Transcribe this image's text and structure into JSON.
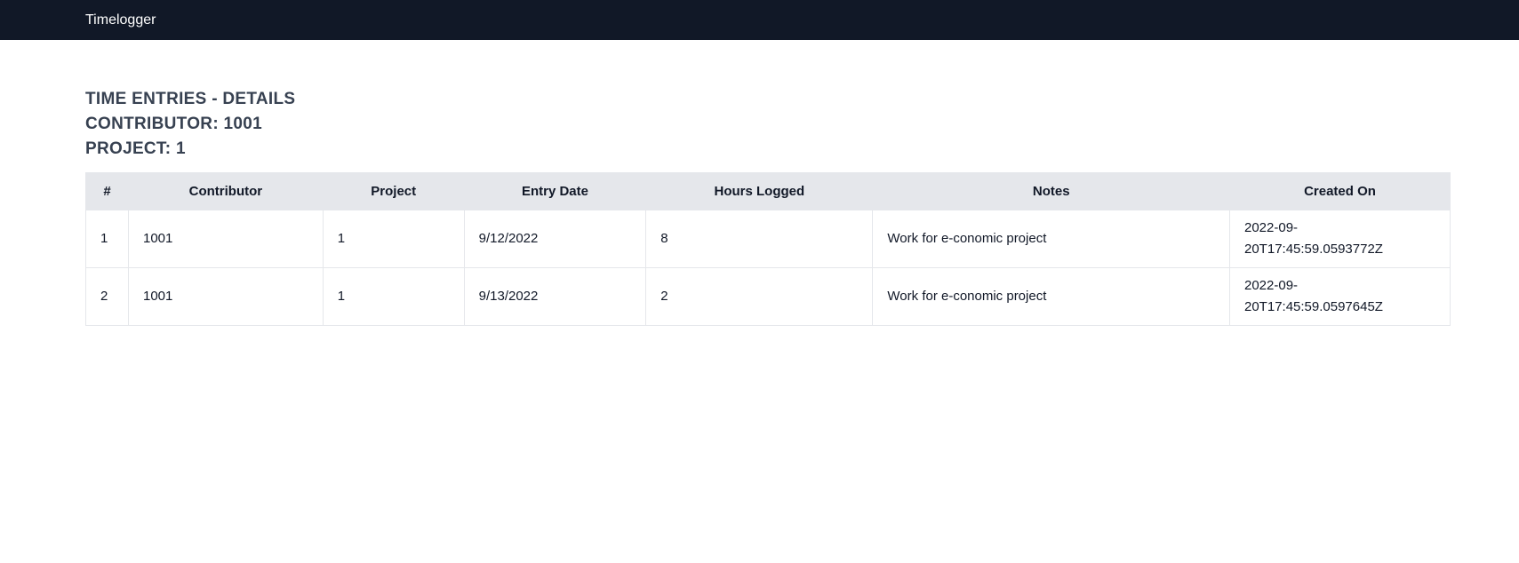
{
  "navbar": {
    "brand": "Timelogger"
  },
  "page": {
    "title": "TIME ENTRIES - DETAILS",
    "contributor_line": "CONTRIBUTOR: 1001",
    "project_line": "PROJECT: 1"
  },
  "table": {
    "headers": [
      "#",
      "Contributor",
      "Project",
      "Entry Date",
      "Hours Logged",
      "Notes",
      "Created On"
    ],
    "rows": [
      {
        "idx": "1",
        "contributor": "1001",
        "project": "1",
        "entry_date": "9/12/2022",
        "hours": "8",
        "notes": "Work for e-conomic project",
        "created_line1": "2022-09-",
        "created_line2": "20T17:45:59.0593772Z"
      },
      {
        "idx": "2",
        "contributor": "1001",
        "project": "1",
        "entry_date": "9/13/2022",
        "hours": "2",
        "notes": "Work for e-conomic project",
        "created_line1": "2022-09-",
        "created_line2": "20T17:45:59.0597645Z"
      }
    ]
  }
}
